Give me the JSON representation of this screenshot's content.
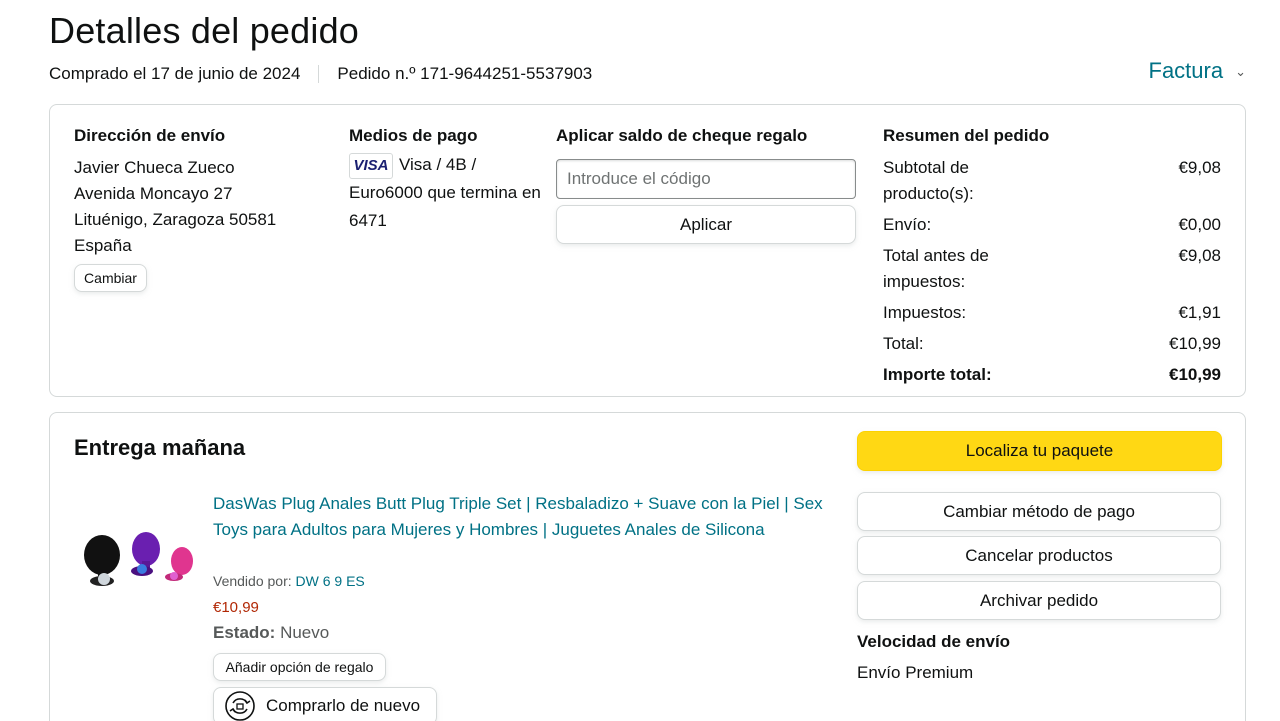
{
  "header": {
    "title": "Detalles del pedido",
    "purchase_date": "Comprado el 17 de junio de 2024",
    "order_number": "Pedido n.º 171-9644251-5537903",
    "invoice_label": "Factura"
  },
  "shipping_address": {
    "title": "Dirección de envío",
    "lines": [
      "Javier Chueca Zueco",
      "Avenida Moncayo 27",
      "Lituénigo, Zaragoza 50581",
      "España"
    ],
    "change_label": "Cambiar"
  },
  "payment": {
    "title": "Medios de pago",
    "card_brand": "VISA",
    "description": "Visa / 4B / Euro6000 que termina en 6471"
  },
  "gift_card": {
    "title": "Aplicar saldo de cheque regalo",
    "placeholder": "Introduce el código",
    "apply_label": "Aplicar"
  },
  "summary": {
    "title": "Resumen del pedido",
    "rows": [
      {
        "label": "Subtotal de producto(s):",
        "value": "€9,08"
      },
      {
        "label": "Envío:",
        "value": "€0,00"
      },
      {
        "label": "Total antes de impuestos:",
        "value": "€9,08"
      },
      {
        "label": "Impuestos:",
        "value": "€1,91"
      },
      {
        "label": "Total:",
        "value": "€10,99"
      },
      {
        "label": "Importe total:",
        "value": "€10,99"
      }
    ]
  },
  "delivery": {
    "title": "Entrega mañana",
    "product_title": "DasWas Plug Anales Butt Plug Triple Set | Resbaladizo + Suave con la Piel | Sex Toys para Adultos para Mujeres y Hombres | Juguetes Anales de Silicona",
    "sold_by_label": "Vendido por:",
    "seller": "DW 6 9 ES",
    "price": "€10,99",
    "condition_label": "Estado:",
    "condition": "Nuevo",
    "gift_option_label": "Añadir opción de regalo",
    "buy_again_label": "Comprarlo de nuevo"
  },
  "actions": {
    "track": "Localiza tu paquete",
    "change_payment": "Cambiar método de pago",
    "cancel": "Cancelar productos",
    "archive": "Archivar pedido",
    "shipping_speed_title": "Velocidad de envío",
    "shipping_speed": "Envío Premium"
  },
  "colors": {
    "link": "#007185",
    "price": "#B12704",
    "primary_button": "#FFD814"
  }
}
